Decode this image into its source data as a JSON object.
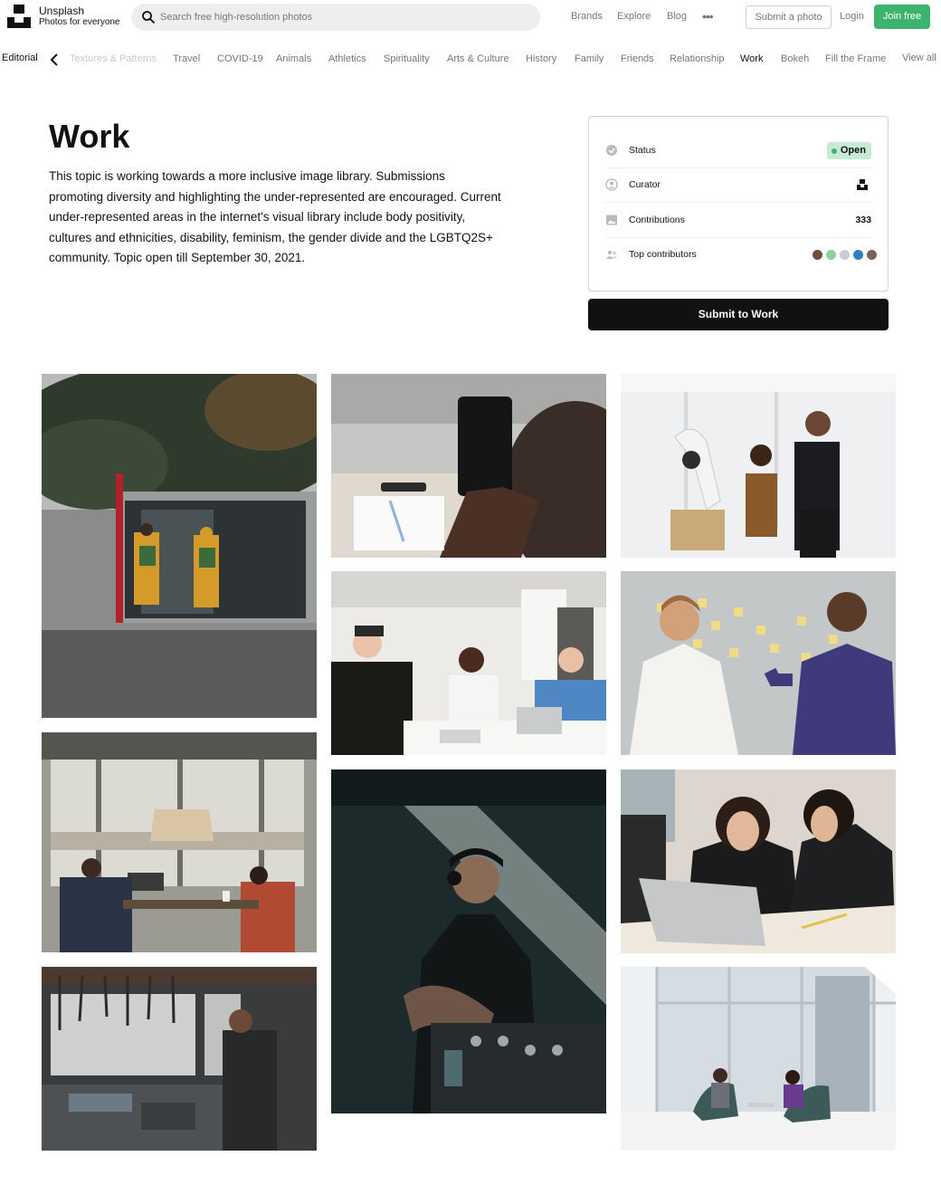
{
  "header": {
    "brand_name": "Unsplash",
    "brand_tagline": "Photos for everyone",
    "search_placeholder": "Search free high-resolution photos",
    "nav": [
      "Brands",
      "Explore",
      "Blog"
    ],
    "submit_photo": "Submit a photo",
    "login": "Login",
    "join": "Join free",
    "join_color": "#3cb46e"
  },
  "topics_nav": {
    "editorial": "Editorial",
    "items": [
      "Textures & Patterns",
      "Travel",
      "COVID-19",
      "Animals",
      "Athletics",
      "Spirituality",
      "Arts & Culture",
      "History",
      "Family",
      "Friends",
      "Relationship",
      "Work",
      "Bokeh",
      "Fill the Frame"
    ],
    "active": "Work",
    "view_all": "View all"
  },
  "topic": {
    "title": "Work",
    "description": "This topic is working towards a more inclusive image library. Submissions promoting diversity and highlighting the under-represented are encouraged. Current under-represented areas in the internet's visual library include body positivity, cultures and ethnicities, disability, feminism, the gender divide and the LGBTQ2S+ community. Topic open till September 30, 2021."
  },
  "info": {
    "status_label": "Status",
    "status_value": "Open",
    "curator_label": "Curator",
    "contributions_label": "Contributions",
    "contributions_value": "333",
    "top_contributors_label": "Top contributors",
    "submit_button": "Submit to Work"
  },
  "photos": [
    {
      "id": "street-workers",
      "desc": "two workers in yellow suits at a bus stop"
    },
    {
      "id": "phone-hand",
      "desc": "hand holding phone over desk"
    },
    {
      "id": "robot-lab",
      "desc": "two people with a robot arm"
    },
    {
      "id": "office-meeting",
      "desc": "women talking at office table"
    },
    {
      "id": "sticky-notes",
      "desc": "two men with sticky notes on glass wall"
    },
    {
      "id": "window-desk",
      "desc": "two people working at a table by window"
    },
    {
      "id": "dj",
      "desc": "DJ with headphones at mixer"
    },
    {
      "id": "laptop-women",
      "desc": "two women looking at laptop"
    },
    {
      "id": "workshop",
      "desc": "man working in a tool workshop"
    },
    {
      "id": "lounge-chairs",
      "desc": "two people in chairs by large window"
    }
  ]
}
